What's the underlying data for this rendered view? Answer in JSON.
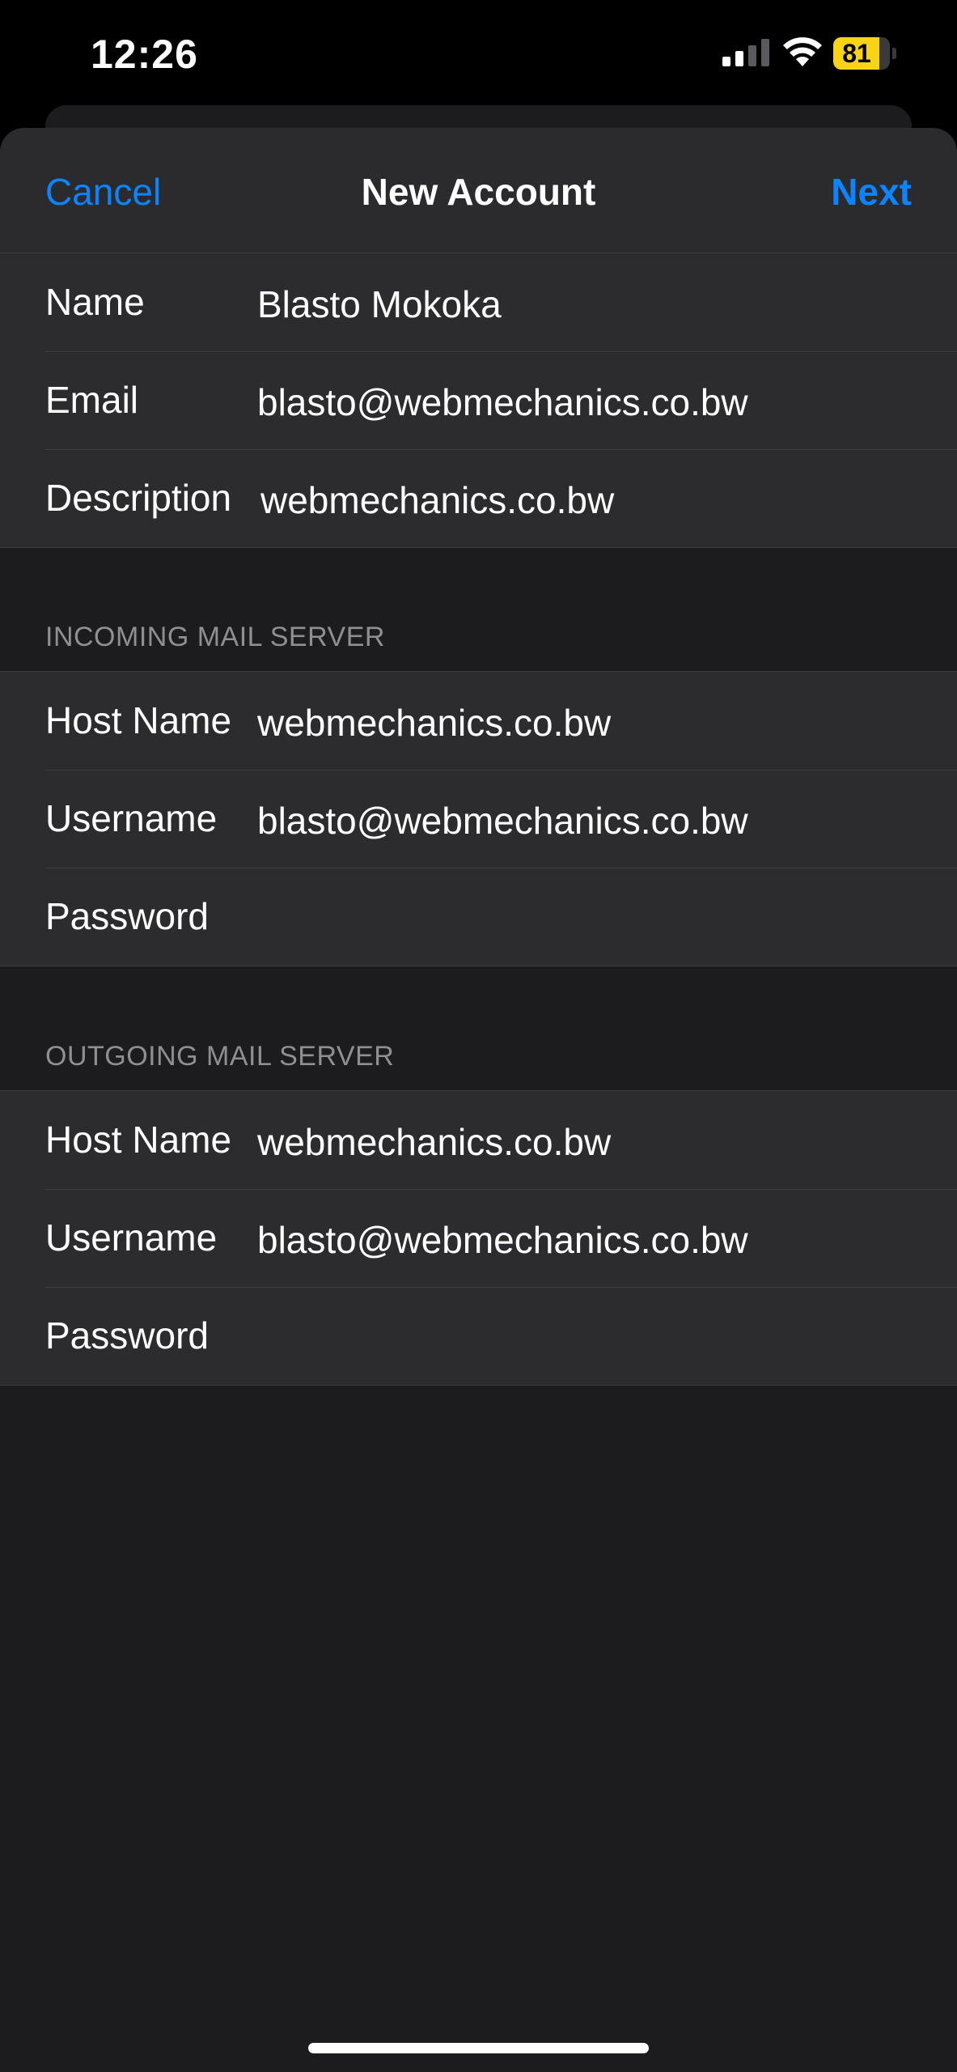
{
  "status_bar": {
    "time": "12:26",
    "battery_percent": "81",
    "battery_level": 0.81,
    "signal_bars_active": 2,
    "signal_bars_total": 4,
    "icons": [
      "signal-icon",
      "wifi-icon",
      "battery-icon"
    ]
  },
  "nav": {
    "cancel_label": "Cancel",
    "title": "New Account",
    "next_label": "Next"
  },
  "account": {
    "name_label": "Name",
    "name_value": "Blasto Mokoka",
    "email_label": "Email",
    "email_value": "blasto@webmechanics.co.bw",
    "description_label": "Description",
    "description_value": "webmechanics.co.bw"
  },
  "incoming": {
    "header": "INCOMING MAIL SERVER",
    "host_label": "Host Name",
    "host_value": "webmechanics.co.bw",
    "username_label": "Username",
    "username_value": "blasto@webmechanics.co.bw",
    "password_label": "Password",
    "password_value": ""
  },
  "outgoing": {
    "header": "OUTGOING MAIL SERVER",
    "host_label": "Host Name",
    "host_value": "webmechanics.co.bw",
    "username_label": "Username",
    "username_value": "blasto@webmechanics.co.bw",
    "password_label": "Password",
    "password_value": ""
  },
  "colors": {
    "accent": "#0a84ff",
    "battery": "#f9d316",
    "background": "#1c1c1e",
    "cell": "#2c2c2e",
    "secondary_text": "#8e8e93"
  }
}
